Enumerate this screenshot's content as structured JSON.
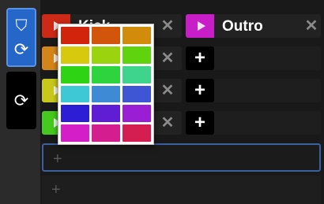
{
  "mode_buttons": [
    {
      "top_icon": "tag-icon",
      "bottom_icon": "loop-icon",
      "active": true,
      "color": "#2467c9"
    },
    {
      "bottom_icon": "loop-icon",
      "active": false,
      "color": "#000000"
    }
  ],
  "glyphs": {
    "tag": "⛉",
    "loop": "⟳",
    "play": "▶",
    "close": "✕",
    "add": "+"
  },
  "clips": [
    {
      "label": "Kick",
      "color": "#cc2a16"
    },
    {
      "color": "#d4851a"
    },
    {
      "color": "#c8c81c"
    },
    {
      "color": "#46c81e"
    },
    {
      "label": "Outro",
      "color": "#c81ec8"
    }
  ],
  "empty_rows": [
    "+",
    "+"
  ],
  "color_picker": {
    "swatches": [
      "#d1240c",
      "#d1560c",
      "#d18c0c",
      "#d6c90e",
      "#9bd40e",
      "#5fd40e",
      "#2ed414",
      "#2ed43e",
      "#3ed48c",
      "#3ec7d4",
      "#3e8ad4",
      "#3e55d4",
      "#2c1ed4",
      "#601ed4",
      "#9a1ed4",
      "#d41ec8",
      "#d41e8f",
      "#d41e52"
    ]
  }
}
